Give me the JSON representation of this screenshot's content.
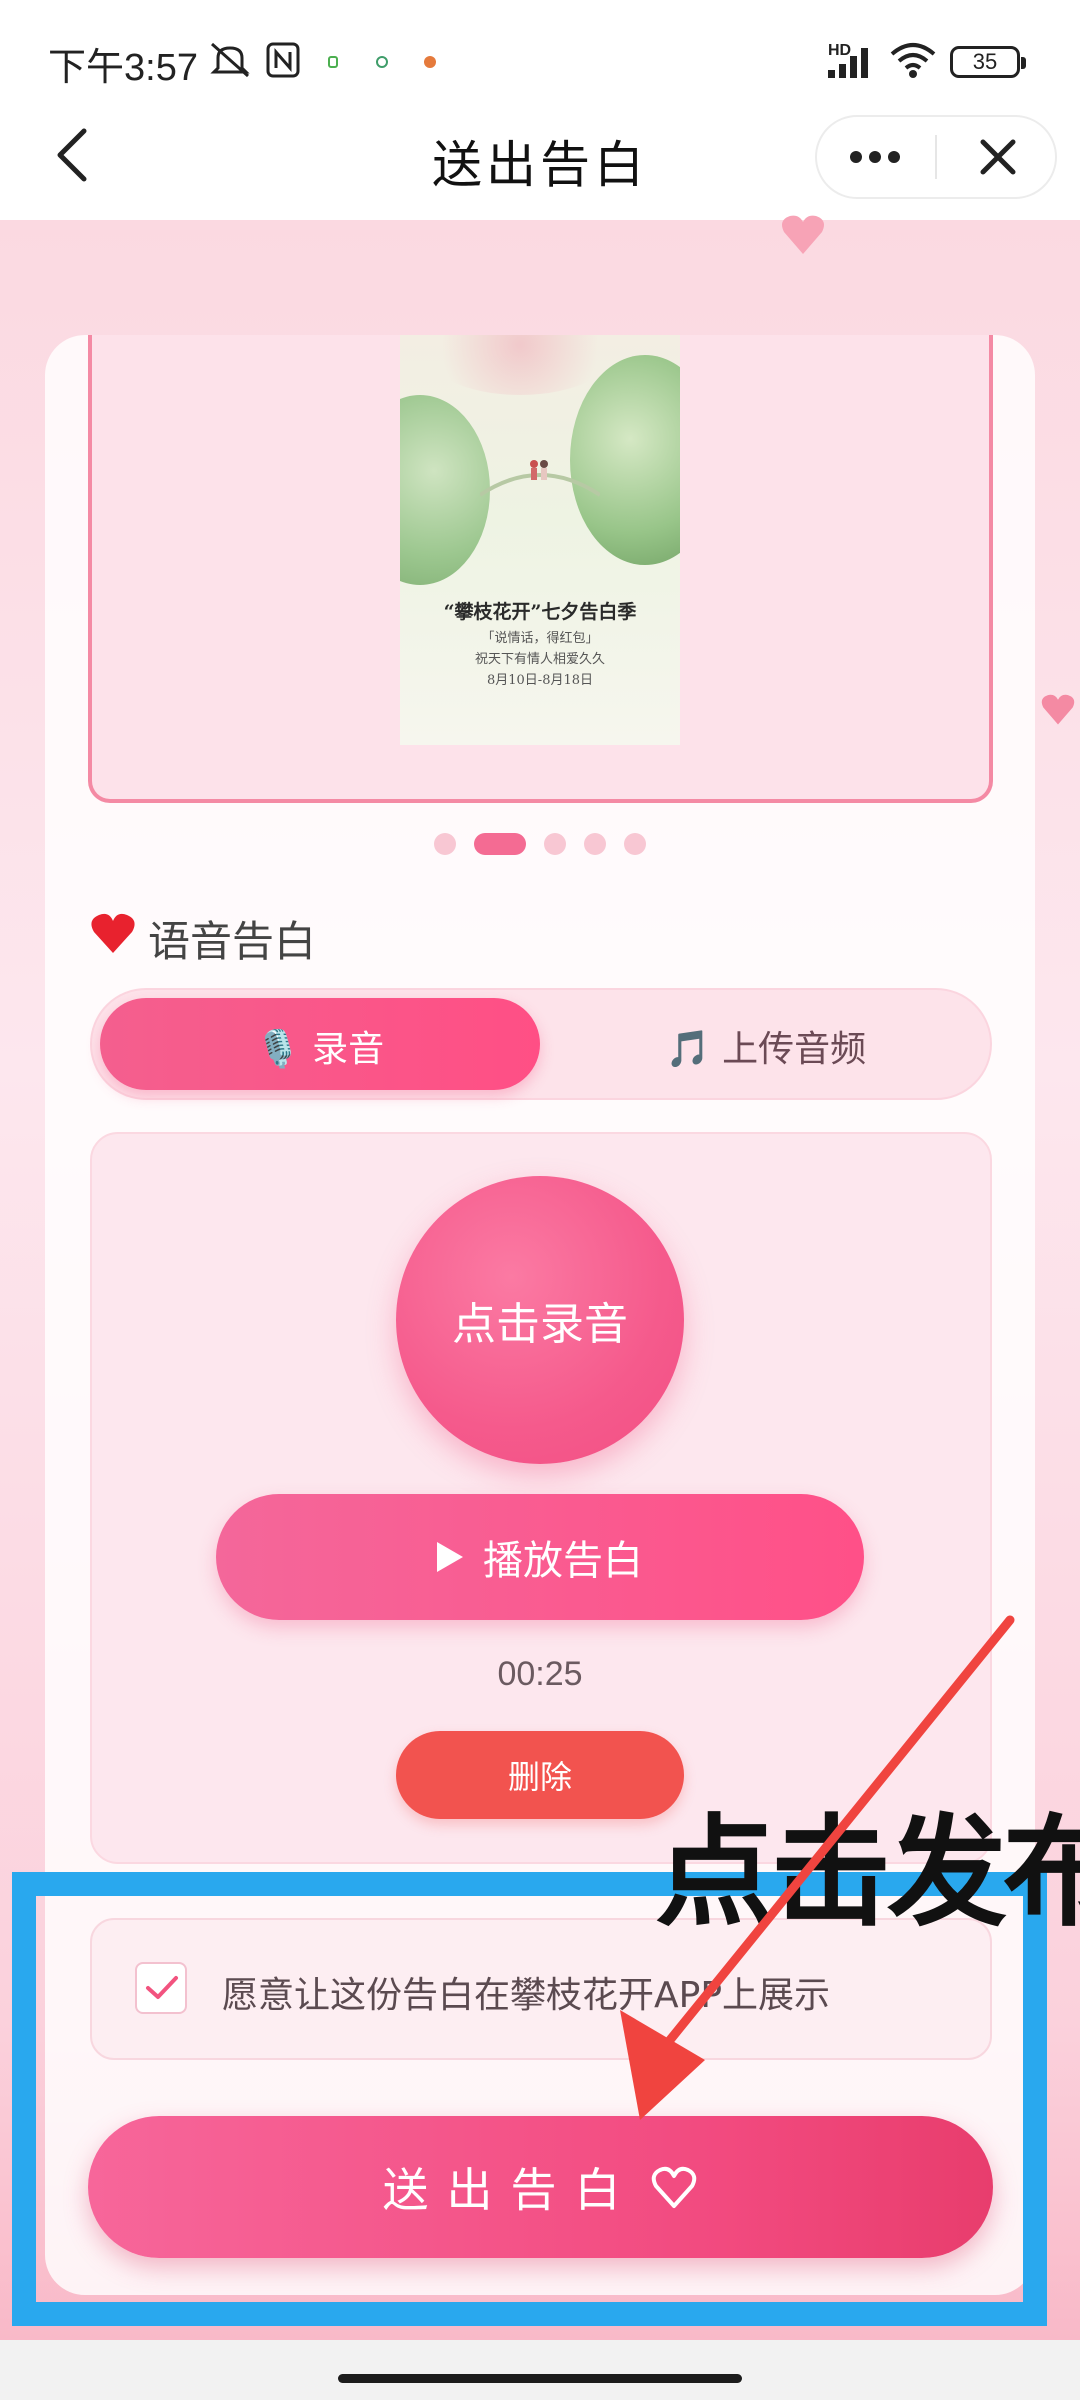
{
  "status_bar": {
    "time": "下午3:57",
    "network": "HD",
    "battery": "35",
    "icons": [
      "mute-bell-icon",
      "nfc-icon",
      "app-notification-icon",
      "signal-icon",
      "wifi-icon",
      "battery-icon"
    ]
  },
  "nav": {
    "title": "送出告白",
    "back_icon": "back-arrow-icon",
    "more_icon": "more-dots-icon",
    "close_icon": "close-icon"
  },
  "carousel": {
    "poster": {
      "title": "“攀枝花开”七夕告白季",
      "line1": "「说情话，得红包」",
      "line2": "祝天下有情人相爱久久",
      "line3": "8月10日-8月18日"
    },
    "dot_count": 5,
    "active_dot": 2
  },
  "section": {
    "icon": "heart-icon",
    "title": "语音告白"
  },
  "tabs": [
    {
      "label": "🎙️ 录音",
      "active": true
    },
    {
      "label": "🎵 上传音频",
      "active": false
    }
  ],
  "recorder": {
    "record_label": "点击录音",
    "play_label": "播放告白",
    "duration": "00:25",
    "delete_label": "删除"
  },
  "consent": {
    "checked": true,
    "label": "愿意让这份告白在攀枝花开APP上展示"
  },
  "send": {
    "label": "送出告白"
  },
  "annotation": {
    "text": "点击发布",
    "frame_color": "#29a8ee",
    "arrow_color": "#f0443f"
  },
  "colors": {
    "accent": "#f24e83",
    "background": "#fbd9e1",
    "delete": "#f2534f"
  }
}
